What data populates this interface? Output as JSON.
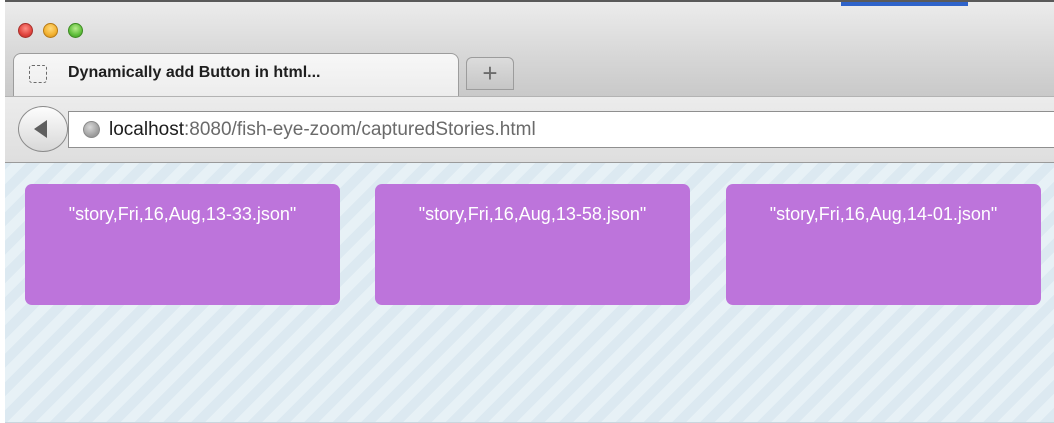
{
  "window": {
    "tab_title": "Dynamically add Button in html...",
    "new_tab_label": "+"
  },
  "address_bar": {
    "host": "localhost",
    "rest": ":8080/fish-eye-zoom/capturedStories.html"
  },
  "icons": {
    "back": "back-arrow-icon",
    "site": "globe-icon",
    "favicon": "blank-page-icon"
  },
  "colors": {
    "story_button": "#bd74db",
    "page_background": "#dce9f1"
  },
  "stories": [
    {
      "label": "\"story,Fri,16,Aug,13-33.json\""
    },
    {
      "label": "\"story,Fri,16,Aug,13-58.json\""
    },
    {
      "label": "\"story,Fri,16,Aug,14-01.json\""
    }
  ]
}
